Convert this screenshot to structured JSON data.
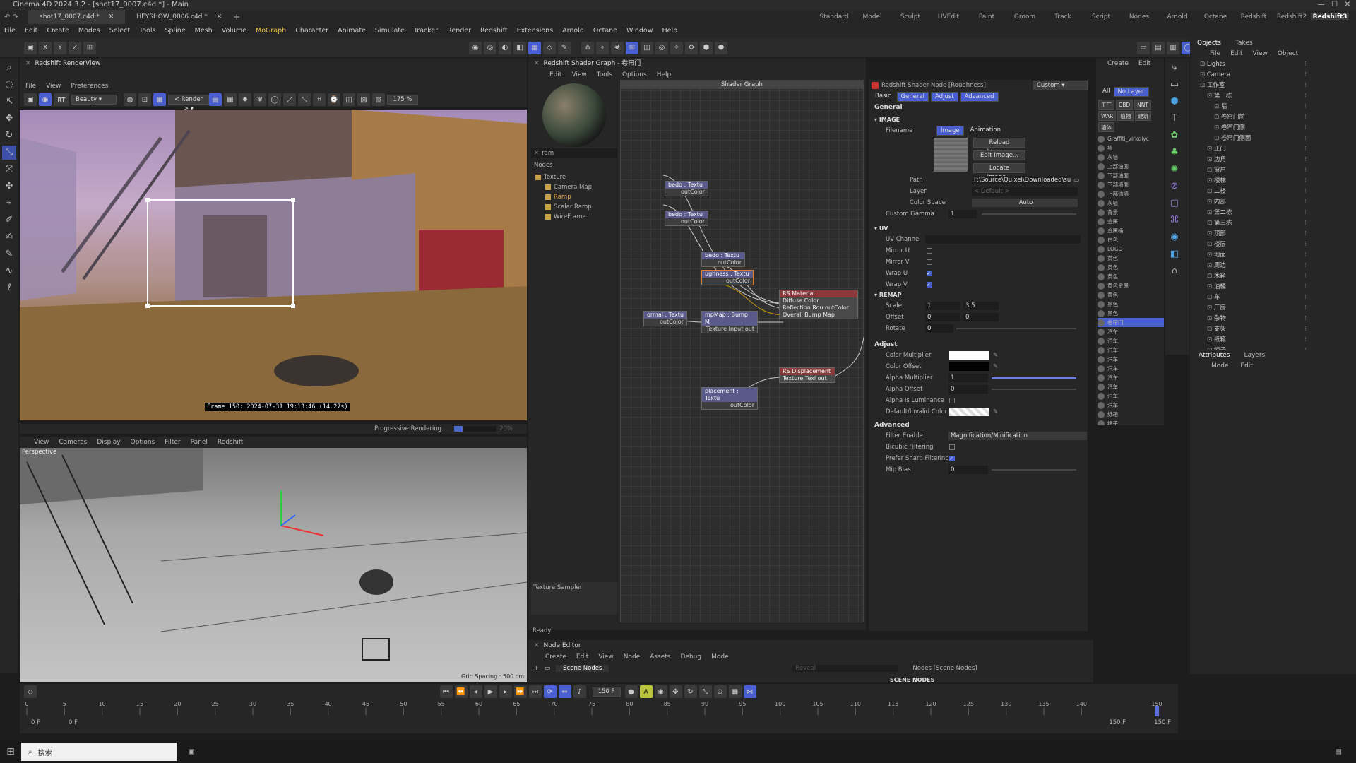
{
  "app": {
    "title": "Cinema 4D 2024.3.2 - [shot17_0007.c4d *] - Main",
    "tabs": [
      "shot17_0007.c4d *",
      "HEYSHOW_0006.c4d *"
    ],
    "layouts": [
      "Standard",
      "Model",
      "Sculpt",
      "UVEdit",
      "Paint",
      "Groom",
      "Track",
      "Script",
      "Nodes",
      "Arnold",
      "Octane",
      "Redshift",
      "Redshift2",
      "Redshift3"
    ],
    "active_layout": "Redshift3"
  },
  "menubar": [
    "File",
    "Edit",
    "Create",
    "Modes",
    "Select",
    "Tools",
    "Spline",
    "Mesh",
    "Volume",
    "MoGraph",
    "Character",
    "Animate",
    "Simulate",
    "Tracker",
    "Render",
    "Redshift",
    "Extensions",
    "Arnold",
    "Octane",
    "Window",
    "Help"
  ],
  "renderview": {
    "title": "Redshift RenderView",
    "menu": [
      "File",
      "View",
      "Preferences"
    ],
    "aov": "Beauty",
    "render_mode": "Render",
    "zoom": "175 %",
    "frame_info": "Frame  150:  2024-07-31  19:13:46  (14.27s)",
    "status": "Progressive Rendering...",
    "progress": "20%"
  },
  "viewport": {
    "menu": [
      "View",
      "Cameras",
      "Display",
      "Options",
      "Filter",
      "Panel",
      "Redshift"
    ],
    "camera": "Perspective",
    "grid_spacing": "Grid Spacing : 500 cm"
  },
  "shader_graph": {
    "title": "Redshift Shader Graph - 卷帘门",
    "menu": [
      "Edit",
      "View",
      "Tools",
      "Options",
      "Help"
    ],
    "canvas_title": "Shader Graph",
    "search": "ram",
    "nodes_label": "Nodes",
    "tree": [
      "Texture",
      "Camera Map",
      "Ramp",
      "Scalar Ramp",
      "WireFrame"
    ],
    "selected_type": "Texture Sampler",
    "status": "Ready",
    "nodes": [
      {
        "title": "bedo : Textu",
        "out": "outColor"
      },
      {
        "title": "bedo : Textu",
        "out": "outColor"
      },
      {
        "title": "bedo : Textu",
        "out": "outColor"
      },
      {
        "title": "ughness : Textu",
        "out": "outColor"
      },
      {
        "title": "ormal : Textu",
        "out": "outColor"
      },
      {
        "title": "mpMap : Bump M",
        "out": "Texture Input  out"
      },
      {
        "title": "placement : Textu",
        "out": "outColor"
      }
    ],
    "material": {
      "title": "RS Material",
      "ports": [
        "Diffuse Color",
        "Reflection Rou outColor",
        "Overall Bump Map"
      ]
    },
    "displacement": {
      "title": "RS Displacement",
      "ports": [
        "Texture Texl out"
      ]
    }
  },
  "attributes": {
    "node_title": "Redshift Shader Node [Roughness]",
    "preset": "Custom",
    "tabs": [
      "Basic",
      "General",
      "Adjust",
      "Advanced"
    ],
    "general": "General",
    "image_section": "IMAGE",
    "filename_label": "Filename",
    "filename_tabs": [
      "Image",
      "Animation"
    ],
    "buttons": [
      "Reload Image...",
      "Edit Image...",
      "Locate Image..."
    ],
    "path_label": "Path",
    "path": "F:\\Source\\Quixel\\Downloaded\\surfa",
    "layer_label": "Layer",
    "layer": "< Default >",
    "color_space_label": "Color Space",
    "color_space": "Auto",
    "custom_gamma_label": "Custom Gamma",
    "custom_gamma": "1",
    "uv_section": "UV",
    "uv_channel_label": "UV Channel",
    "mirror_u": "Mirror U",
    "mirror_v": "Mirror V",
    "wrap_u": "Wrap U",
    "wrap_v": "Wrap V",
    "remap_section": "REMAP",
    "scale_label": "Scale",
    "scale": [
      "1",
      "3.5"
    ],
    "offset_label": "Offset",
    "offset": [
      "0",
      "0"
    ],
    "rotate_label": "Rotate",
    "rotate": "0",
    "adjust_section": "Adjust",
    "color_multiplier": "Color Multiplier",
    "color_offset": "Color Offset",
    "alpha_multiplier_label": "Alpha Multiplier",
    "alpha_multiplier": "1",
    "alpha_offset_label": "Alpha Offset",
    "alpha_offset": "0",
    "alpha_is_luminance": "Alpha Is Luminance",
    "default_color": "Default/Invalid Color",
    "advanced_section": "Advanced",
    "filter_enable_label": "Filter Enable",
    "filter_enable": "Magnification/Minification",
    "bicubic": "Bicubic Filtering",
    "prefer_sharp": "Prefer Sharp Filtering",
    "mip_bias_label": "Mip Bias",
    "mip_bias": "0"
  },
  "layer_panel": {
    "menu": [
      "Create",
      "Edit"
    ],
    "filters": [
      "All",
      "No Layer"
    ],
    "tags": [
      "工厂",
      "CBD",
      "NNT",
      "WAR",
      "植物",
      "建筑",
      "墙体"
    ],
    "materials": [
      "Graffiti_virkdiyc",
      "墙",
      "灰墙",
      "上部油面",
      "下部油面",
      "下部墙面",
      "上部油墙",
      "灰墙",
      "背景",
      "金属",
      "金属桶",
      "白色",
      "LOGO",
      "黄色",
      "黄色",
      "黄色",
      "黄色金属",
      "黄色",
      "黑色",
      "黑色",
      "卷帘门",
      "汽车",
      "汽车",
      "汽车",
      "汽车",
      "汽车",
      "汽车",
      "汽车",
      "汽车",
      "汽车",
      "纸箱",
      "绳子"
    ]
  },
  "objects_panel": {
    "tabs": [
      "Objects",
      "Takes"
    ],
    "menu": [
      "File",
      "Edit",
      "View",
      "Object"
    ],
    "items": [
      "Lights",
      "Camera",
      "工作室",
      "第一栋",
      "墙",
      "卷帘门前",
      "卷帘门侧",
      "卷帘门侧面",
      "正门",
      "边角",
      "窗户",
      "楼梯",
      "二楼",
      "内部",
      "第二栋",
      "第三栋",
      "顶部",
      "楼层",
      "地面",
      "周边",
      "木箱",
      "油桶",
      "车",
      "厂房",
      "杂物",
      "支架",
      "纸箱",
      "绳子"
    ],
    "attr_tabs": [
      "Attributes",
      "Layers"
    ],
    "attr_menu": [
      "Mode",
      "Edit"
    ]
  },
  "node_editor": {
    "title": "Node Editor",
    "menu": [
      "Create",
      "Edit",
      "View",
      "Node",
      "Assets",
      "Debug",
      "Mode"
    ],
    "tab": "Scene Nodes",
    "reveal": "Reveal",
    "nodes_label": "Nodes [Scene Nodes]",
    "scene_nodes": "SCENE NODES"
  },
  "timeline": {
    "current_frame": "150 F",
    "start": "0 F",
    "start2": "0 F",
    "end": "150 F",
    "end2": "150 F",
    "ticks": [
      "0",
      "5",
      "10",
      "15",
      "20",
      "25",
      "30",
      "35",
      "40",
      "45",
      "50",
      "55",
      "60",
      "65",
      "70",
      "75",
      "80",
      "85",
      "90",
      "95",
      "100",
      "105",
      "110",
      "115",
      "120",
      "125",
      "130",
      "135",
      "140",
      "150"
    ]
  },
  "taskbar": {
    "search": "搜索"
  }
}
